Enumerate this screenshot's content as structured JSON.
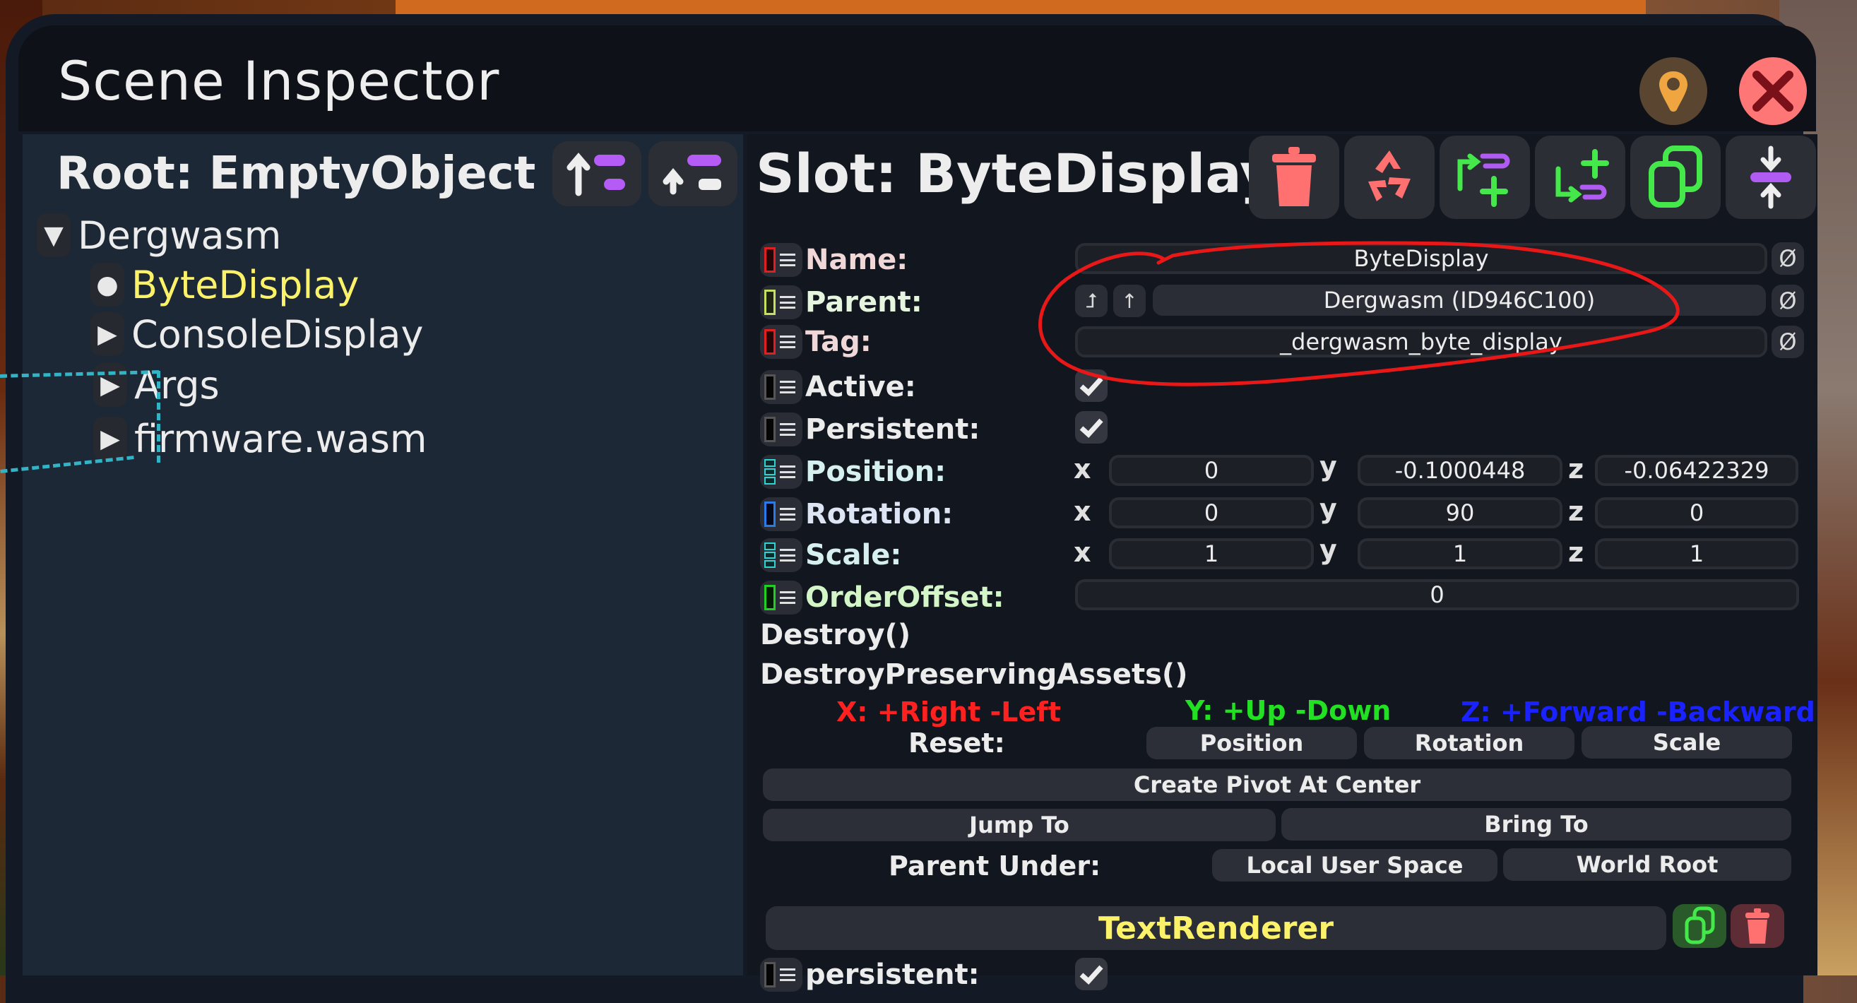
{
  "window": {
    "title": "Scene Inspector",
    "locate_icon": "map-pin-icon",
    "close_icon": "close-x-icon"
  },
  "hierarchy": {
    "root_label": "Root: EmptyObject",
    "tools": [
      {
        "name": "go-to-root-parent",
        "icon": "arrow-up-list-icon"
      },
      {
        "name": "go-up-one-level",
        "icon": "small-arrow-up-list-icon"
      }
    ],
    "items": [
      {
        "label": "Dergwasm",
        "toggle": "▼",
        "depth": 0,
        "selected": false
      },
      {
        "label": "ByteDisplay",
        "toggle": "●",
        "depth": 1,
        "selected": true
      },
      {
        "label": "ConsoleDisplay",
        "toggle": "▶",
        "depth": 1,
        "selected": false
      },
      {
        "label": "Args",
        "toggle": "▶",
        "depth": 1,
        "selected": false
      },
      {
        "label": "firmware.wasm",
        "toggle": "▶",
        "depth": 1,
        "selected": false
      }
    ]
  },
  "slot": {
    "title": "Slot: ByteDisplay",
    "header_buttons": [
      {
        "name": "destroy",
        "icon": "trash-icon",
        "color": "#ff7070"
      },
      {
        "name": "destroy-preserving-assets",
        "icon": "recycle-icon",
        "color": "#ff7070"
      },
      {
        "name": "insert-parent",
        "icon": "insert-parent-icon",
        "color": "#44e84a"
      },
      {
        "name": "add-child",
        "icon": "add-child-icon",
        "color": "#44e84a"
      },
      {
        "name": "duplicate",
        "icon": "duplicate-icon",
        "color": "#44e84a"
      },
      {
        "name": "center-pivot",
        "icon": "compress-vertical-icon",
        "color": "#b05cf2"
      }
    ],
    "fields": {
      "name": {
        "label": "Name:",
        "value": "ByteDisplay",
        "color": "#f1d8d8",
        "indicator": "#e02020"
      },
      "parent": {
        "label": "Parent:",
        "value": "Dergwasm (ID946C100)",
        "color": "#e6f5de",
        "indicator": "#c8e060"
      },
      "tag": {
        "label": "Tag:",
        "value": "_dergwasm_byte_display",
        "color": "#f1d8d8",
        "indicator": "#e02020"
      },
      "active": {
        "label": "Active:",
        "checked": true,
        "color": "#ececec",
        "indicator": "#555555"
      },
      "persistent": {
        "label": "Persistent:",
        "checked": true,
        "color": "#ececec",
        "indicator": "#555555"
      },
      "position": {
        "label": "Position:",
        "x": "0",
        "y": "-0.1000448",
        "z": "-0.06422329",
        "color": "#d6f0f0",
        "indicator": "#2fd3d3"
      },
      "rotation": {
        "label": "Rotation:",
        "x": "0",
        "y": "90",
        "z": "0",
        "color": "#dde4f3",
        "indicator": "#2a7ae8"
      },
      "scale": {
        "label": "Scale:",
        "x": "1",
        "y": "1",
        "z": "1",
        "color": "#d6f0f0",
        "indicator": "#2fd3d3"
      },
      "order_offset": {
        "label": "OrderOffset:",
        "value": "0",
        "color": "#d4f5c8",
        "indicator": "#22d022"
      }
    },
    "axis_labels": {
      "x": "x",
      "y": "y",
      "z": "z"
    },
    "null_symbol": "Ø",
    "parent_buttons": [
      "⮥",
      "↑"
    ],
    "methods": [
      "Destroy()",
      "DestroyPreservingAssets()"
    ],
    "axis_legend": {
      "x": {
        "text": "X: +Right -Left",
        "color": "#ff2020"
      },
      "y": {
        "text": "Y: +Up -Down",
        "color": "#22e022"
      },
      "z": {
        "text": "Z: +Forward -Backward",
        "color": "#1a22ff"
      }
    },
    "reset": {
      "label": "Reset:",
      "buttons": [
        "Position",
        "Rotation",
        "Scale"
      ]
    },
    "create_pivot": "Create Pivot At Center",
    "jump_to": "Jump To",
    "bring_to": "Bring To",
    "parent_under": {
      "label": "Parent Under:",
      "buttons": [
        "Local User Space",
        "World Root"
      ]
    },
    "component": {
      "title": "TextRenderer",
      "first_field": "persistent:",
      "first_field_checked": true
    }
  },
  "annotation": {
    "color": "#e81818",
    "description": "hand-drawn red circle around Parent and Tag fields"
  }
}
